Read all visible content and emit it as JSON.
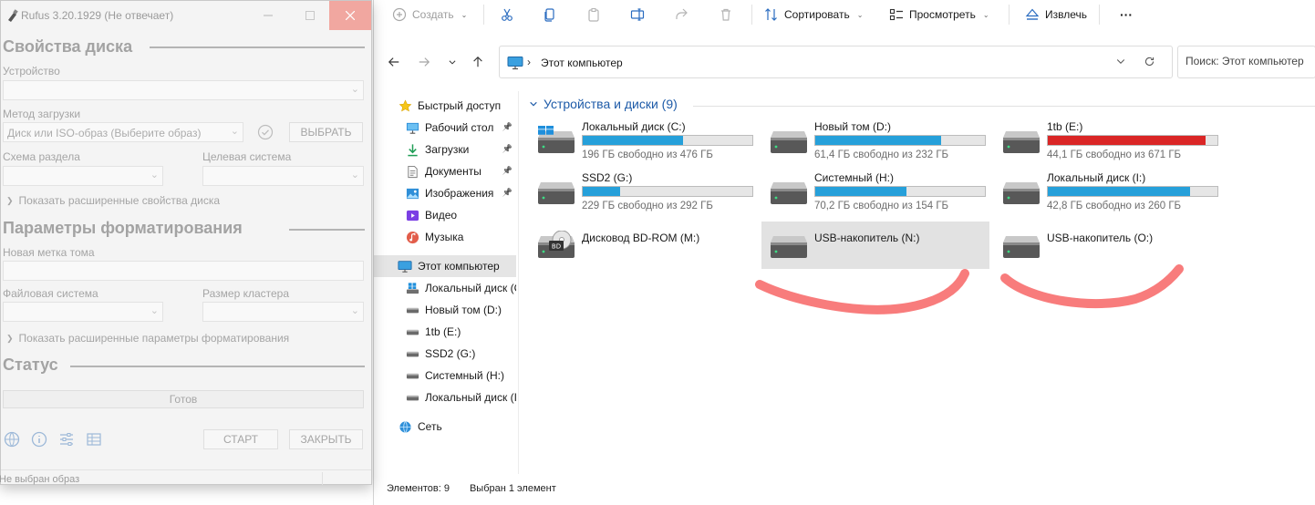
{
  "explorer": {
    "toolbar": {
      "create": "Создать",
      "sort": "Сортировать",
      "view": "Просмотреть",
      "eject": "Извлечь",
      "more": "···"
    },
    "address": {
      "separator": "›",
      "path": "Этот компьютер"
    },
    "search": {
      "placeholder": "Поиск: Этот компьютер"
    },
    "sidebar": [
      {
        "label": "Быстрый доступ",
        "icon": "star-icon",
        "pinned": false
      },
      {
        "label": "Рабочий стол",
        "icon": "desktop-icon",
        "pinned": true
      },
      {
        "label": "Загрузки",
        "icon": "download-icon",
        "pinned": true
      },
      {
        "label": "Документы",
        "icon": "document-icon",
        "pinned": true
      },
      {
        "label": "Изображения",
        "icon": "image-icon",
        "pinned": true
      },
      {
        "label": "Видео",
        "icon": "video-icon",
        "pinned": false
      },
      {
        "label": "Музыка",
        "icon": "music-icon",
        "pinned": false
      },
      {
        "label": "Этот компьютер",
        "icon": "computer-icon",
        "pinned": false,
        "selected": true
      },
      {
        "label": "Локальный диск (C",
        "icon": "windows-drive-icon",
        "pinned": false
      },
      {
        "label": "Новый том (D:)",
        "icon": "drive-icon",
        "pinned": false
      },
      {
        "label": "1tb (E:)",
        "icon": "drive-icon",
        "pinned": false
      },
      {
        "label": "SSD2 (G:)",
        "icon": "drive-icon",
        "pinned": false
      },
      {
        "label": "Системный (H:)",
        "icon": "drive-icon",
        "pinned": false
      },
      {
        "label": "Локальный диск (I",
        "icon": "drive-icon",
        "pinned": false
      },
      {
        "label": "Сеть",
        "icon": "network-icon",
        "pinned": false
      }
    ],
    "group_title": "Устройства и диски (9)",
    "drives": [
      {
        "name": "Локальный диск (C:)",
        "free": "196 ГБ свободно из 476 ГБ",
        "used": 0.59,
        "kind": "windows"
      },
      {
        "name": "Новый том (D:)",
        "free": "61,4 ГБ свободно из 232 ГБ",
        "used": 0.74,
        "kind": "hdd"
      },
      {
        "name": "1tb (E:)",
        "free": "44,1 ГБ свободно из 671 ГБ",
        "used": 0.93,
        "kind": "hdd",
        "warning": true
      },
      {
        "name": "SSD2 (G:)",
        "free": "229 ГБ свободно из 292 ГБ",
        "used": 0.22,
        "kind": "hdd"
      },
      {
        "name": "Системный (H:)",
        "free": "70,2 ГБ свободно из 154 ГБ",
        "used": 0.54,
        "kind": "hdd"
      },
      {
        "name": "Локальный диск (I:)",
        "free": "42,8 ГБ свободно из 260 ГБ",
        "used": 0.84,
        "kind": "hdd"
      },
      {
        "name": "Дисковод BD-ROM (M:)",
        "kind": "bd"
      },
      {
        "name": "USB-накопитель (N:)",
        "kind": "hdd",
        "selected": true
      },
      {
        "name": "USB-накопитель (O:)",
        "kind": "hdd"
      }
    ],
    "status": {
      "items": "Элементов: 9",
      "selected": "Выбран 1 элемент"
    }
  },
  "rufus": {
    "title": "Rufus 3.20.1929  (Не отвечает)",
    "sections": {
      "drive_props": "Свойства диска",
      "format_opts": "Параметры форматирования",
      "status": "Статус"
    },
    "labels": {
      "device": "Устройство",
      "boot_method": "Метод загрузки",
      "partition": "Схема раздела",
      "target": "Целевая система",
      "volume_label": "Новая метка тома",
      "filesystem": "Файловая система",
      "cluster": "Размер кластера"
    },
    "boot_value": "Диск или ISO-образ (Выберите образ)",
    "select_button": "ВЫБРАТЬ",
    "adv_drive": "Показать расширенные свойства диска",
    "adv_format": "Показать расширенные параметры форматирования",
    "status_text": "Готов",
    "start_button": "СТАРТ",
    "close_button": "ЗАКРЫТЬ",
    "footer": "Не выбран образ"
  },
  "colors": {
    "accent": "#26a0da",
    "warning": "#da2626",
    "scribble": "#f87c7c"
  }
}
